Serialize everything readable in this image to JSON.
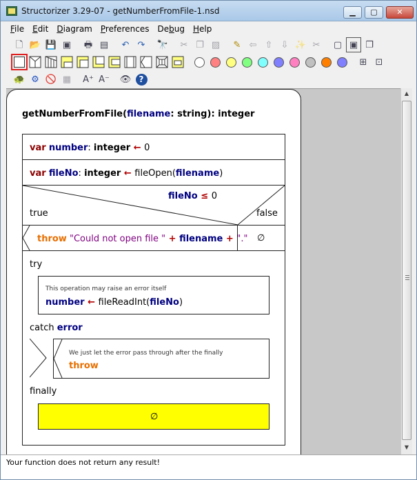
{
  "window": {
    "title": "Structorizer 3.29-07 - getNumberFromFile-1.nsd",
    "min": "▁",
    "max": "▢",
    "close": "✕"
  },
  "menu": {
    "file": {
      "u": "F",
      "rest": "ile"
    },
    "edit": {
      "u": "E",
      "rest": "dit"
    },
    "diagram": {
      "u": "D",
      "rest": "iagram"
    },
    "preferences": {
      "u": "P",
      "rest": "references"
    },
    "debug": {
      "pre": "De",
      "u": "b",
      "rest": "ug"
    },
    "help": {
      "u": "H",
      "rest": "elp"
    }
  },
  "toolbar1": {
    "icons": [
      "new-icon",
      "open-icon",
      "save-icon",
      "save-all-icon",
      "print-icon",
      "export-icon",
      "undo-icon",
      "redo-icon",
      "find-icon",
      "cut-icon",
      "copy-icon",
      "paste-icon",
      "edit-icon",
      "move-left-icon",
      "move-up-icon",
      "move-down-icon",
      "transmute-icon",
      "collapse-icon",
      "zoom-in-icon",
      "zoom-out-icon"
    ],
    "glyphs": {
      "new": "🗋",
      "open": "📂",
      "save": "💾",
      "save_all": "▣",
      "print": "🖶",
      "export": "▤",
      "undo": "↶",
      "redo": "↷",
      "find": "🔭",
      "cut": "✂",
      "copy": "❐",
      "paste": "▨",
      "edit": "✎",
      "move_left": "⇦",
      "move_up": "⇧",
      "move_down": "⇩",
      "transmute": "✨",
      "box1": "▢",
      "box2": "▣",
      "box3": "❐"
    }
  },
  "toolbar2": {
    "element_labels": {
      "for": "FOR",
      "try": "TRY"
    },
    "colors": [
      "#ffffff",
      "#ff8080",
      "#ffff80",
      "#80ff80",
      "#80ffff",
      "#8080ff",
      "#ff80c0",
      "#c0c0c0",
      "#ff8000",
      "#8080ff"
    ],
    "extra": {
      "a": "⊞",
      "b": "⊡"
    }
  },
  "toolbar3": {
    "glyphs": {
      "turtle": "🐢",
      "run": "⚙",
      "stop": "🚫",
      "grid": "▦",
      "font_up": "A⁺",
      "font_down": "A⁻",
      "view": "👁",
      "help": "?"
    }
  },
  "diagram": {
    "title": {
      "name": "getNumberFromFile",
      "lp": "(",
      "param": "filename",
      "colon": ": ",
      "ptype": "string",
      "rp": "): ",
      "rtype": "integer"
    },
    "line1": {
      "kw": "var",
      "var": "number",
      "colon": ": ",
      "type": "integer",
      "arrow": " ← ",
      "val": "0"
    },
    "line2": {
      "kw": "var",
      "var": "fileNo",
      "colon": ": ",
      "type": "integer",
      "arrow": " ← ",
      "fn": "fileOpen(",
      "arg": "filename",
      "rp": ")"
    },
    "if": {
      "var": "fileNo",
      "op": " ≤ ",
      "val": "0",
      "true_label": "true",
      "false_label": "false"
    },
    "throw_line": {
      "kw": "throw",
      "str1": " \"Could not open file \"",
      "plus1": " + ",
      "var": "filename",
      "plus2": " + ",
      "str2": "\".\""
    },
    "empty_symbol": "∅",
    "try_label": "try",
    "try_comment": "This operation may raise an error itself",
    "try_line": {
      "var": "number",
      "arrow": " ← ",
      "fn": "fileReadInt(",
      "arg": "fileNo",
      "rp": ")"
    },
    "catch": {
      "label": "catch ",
      "var": "error"
    },
    "catch_comment": "We just let the error pass through after the finally",
    "catch_throw": "throw",
    "finally_label": "finally",
    "finally_empty": "∅"
  },
  "scrollbar": {
    "up": "▲",
    "down": "▼"
  },
  "status": {
    "text": "Your function does not return any result!"
  }
}
